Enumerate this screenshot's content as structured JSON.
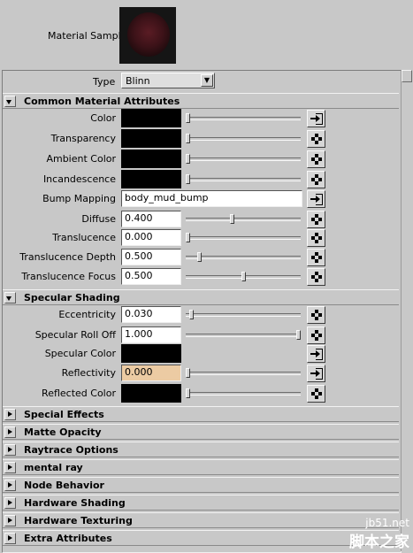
{
  "material_sample": {
    "label": "Material Sample"
  },
  "type": {
    "label": "Type",
    "value": "Blinn"
  },
  "sections": {
    "common": {
      "title": "Common Material Attributes",
      "rows": [
        {
          "label": "Color",
          "kind": "swatch",
          "slider": 0.0,
          "button": "map-arrow"
        },
        {
          "label": "Transparency",
          "kind": "swatch",
          "slider": 0.0,
          "button": "checker"
        },
        {
          "label": "Ambient Color",
          "kind": "swatch",
          "slider": 0.0,
          "button": "checker"
        },
        {
          "label": "Incandescence",
          "kind": "swatch",
          "slider": 0.0,
          "button": "checker"
        },
        {
          "label": "Bump Mapping",
          "kind": "text",
          "value": "body_mud_bump",
          "button": "map-arrow"
        },
        {
          "label": "Diffuse",
          "kind": "field",
          "value": "0.400",
          "slider": 0.4,
          "button": "checker"
        },
        {
          "label": "Translucence",
          "kind": "field",
          "value": "0.000",
          "slider": 0.0,
          "button": "checker"
        },
        {
          "label": "Translucence Depth",
          "kind": "field",
          "value": "0.500",
          "slider": 0.1,
          "button": "checker"
        },
        {
          "label": "Translucence Focus",
          "kind": "field",
          "value": "0.500",
          "slider": 0.5,
          "button": "checker"
        }
      ]
    },
    "specular": {
      "title": "Specular Shading",
      "rows": [
        {
          "label": "Eccentricity",
          "kind": "field",
          "value": "0.030",
          "slider": 0.03,
          "button": "checker"
        },
        {
          "label": "Specular Roll Off",
          "kind": "field",
          "value": "1.000",
          "slider": 1.0,
          "button": "checker"
        },
        {
          "label": "Specular Color",
          "kind": "swatch",
          "slider": null,
          "button": "map-arrow"
        },
        {
          "label": "Reflectivity",
          "kind": "field",
          "value": "0.000",
          "slider": 0.0,
          "button": "map-arrow",
          "highlight": true
        },
        {
          "label": "Reflected Color",
          "kind": "swatch",
          "slider": 0.0,
          "button": "checker"
        }
      ]
    },
    "collapsed": [
      "Special Effects",
      "Matte Opacity",
      "Raytrace Options",
      "mental ray",
      "Node Behavior",
      "Hardware Shading",
      "Hardware Texturing",
      "Extra Attributes"
    ]
  },
  "watermark": {
    "line1": "jb51.net",
    "line2": "脚本之家"
  },
  "colors": {
    "panel": "#c8c8c8",
    "swatch": "#000000",
    "highlight": "#eccba3"
  }
}
